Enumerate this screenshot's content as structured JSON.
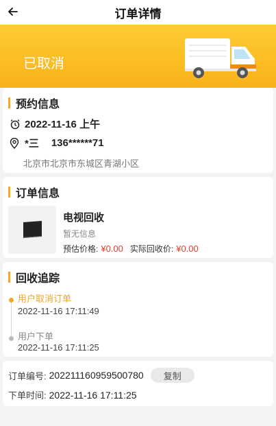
{
  "header": {
    "title": "订单详情",
    "back_icon": "back-arrow-icon"
  },
  "banner": {
    "status": "已取消",
    "illustration_icon": "delivery-truck-icon",
    "colors": {
      "top": "#ffcc33",
      "bottom": "#f9b21a"
    }
  },
  "appointment": {
    "title": "预约信息",
    "datetime": "2022-11-16 上午",
    "contact_name": "*三",
    "phone": "136******71",
    "address": "北京市北京市东城区青湖小区",
    "icons": {
      "time": "alarm-clock-icon",
      "location": "location-pin-icon"
    }
  },
  "order_info": {
    "title": "订单信息",
    "product_name": "电视回收",
    "product_desc": "暂无信息",
    "estimated_label": "预估价格:",
    "estimated_price": "¥0.00",
    "actual_label": "实际回收价:",
    "actual_price": "¥0.00",
    "image_icon": "tv-icon"
  },
  "tracking": {
    "title": "回收追踪",
    "events": [
      {
        "label": "用户取消订单",
        "time": "2022-11-16 17:11:49",
        "active": true
      },
      {
        "label": "用户下单",
        "time": "2022-11-16 17:11:25",
        "active": false
      }
    ]
  },
  "meta": {
    "order_no_label": "订单编号:",
    "order_no": "202211160959500780",
    "copy_label": "复制",
    "order_time_label": "下单时间:",
    "order_time": "2022-11-16 17:11:25"
  },
  "colors": {
    "accent": "#f5a623",
    "price": "#e23b2e"
  }
}
